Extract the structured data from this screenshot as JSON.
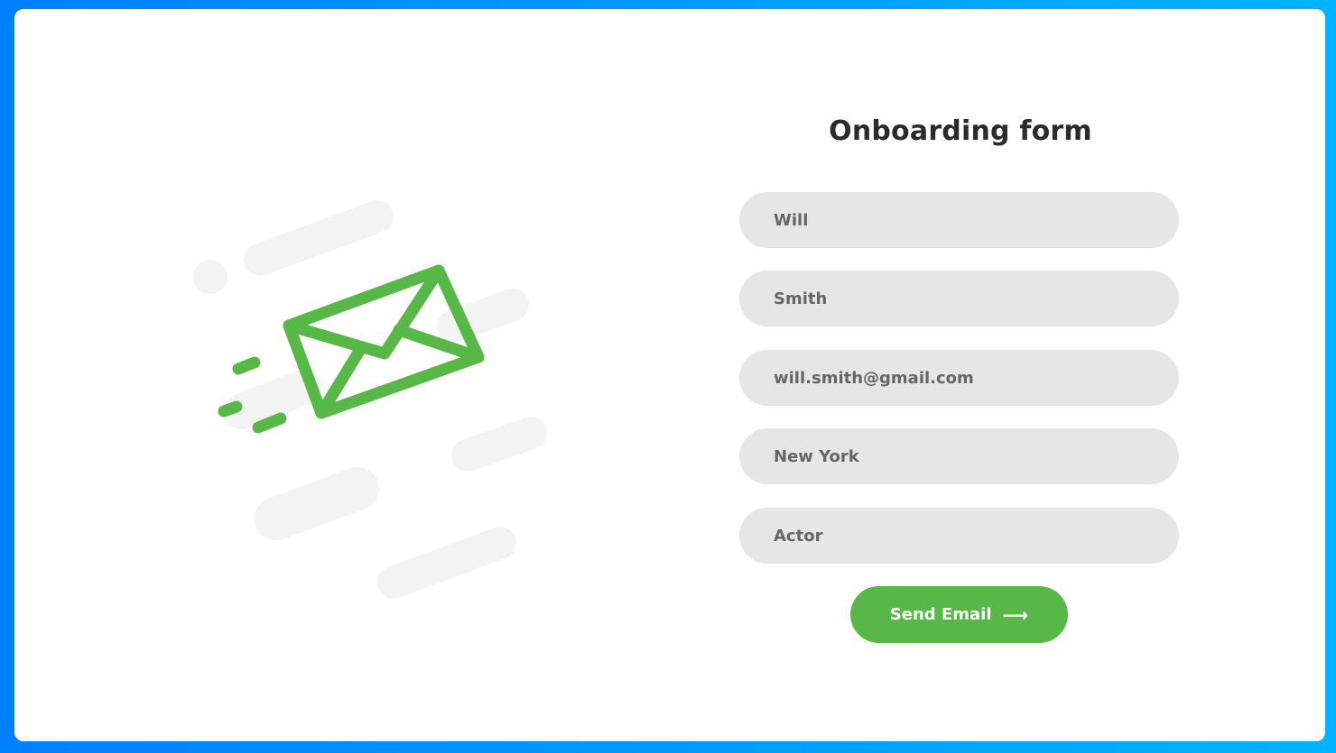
{
  "form": {
    "title": "Onboarding form",
    "fields": [
      {
        "value": "Will"
      },
      {
        "value": "Smith"
      },
      {
        "value": "will.smith@gmail.com"
      },
      {
        "value": "New York"
      },
      {
        "value": "Actor"
      }
    ],
    "submit_label": "Send Email",
    "submit_icon": "arrow-right-icon"
  },
  "illustration": {
    "icon": "envelope-icon"
  },
  "colors": {
    "background_gradient_start": "#0080ff",
    "background_gradient_end": "#00b4ff",
    "accent": "#57b847",
    "field_background": "#e6e6e6",
    "field_text": "#666666",
    "title_text": "#2b2b2b",
    "decor": "#f3f3f3"
  }
}
